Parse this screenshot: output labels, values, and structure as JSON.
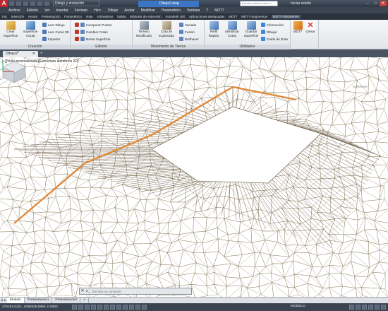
{
  "title_bar": {
    "logo": "A",
    "workspace": "Dibujo y anotación",
    "file_title": "Dibujo2.dwg",
    "search_placeholder": "Escriba palabra clave o frase",
    "login": "Iniciar sesión",
    "window_controls": [
      "–",
      "□",
      "✕"
    ]
  },
  "menu": [
    "Archivo",
    "Edición",
    "Ver",
    "Insertar",
    "Formato",
    "Herr.",
    "Dibujo",
    "Acotar",
    "Modificar",
    "Paramétrico",
    "Ventana",
    "?",
    "MDT7"
  ],
  "ribbon_tabs": [
    "Inic",
    "Inserción",
    "Anotar",
    "Presentación",
    "Paramétrico",
    "Vista",
    "Administrar",
    "Salida",
    "Módulos de extensión",
    "Autodesk 360",
    "Aplicaciones destacadas",
    "MDT7",
    "MDT7-Segmentos",
    "MDT7-Volúmenes"
  ],
  "ribbon": {
    "creation": {
      "title": "Creación",
      "crear_superficie": "Crear Superficie",
      "superficie_actual": "Superficie Actual",
      "leer_dibujo": "Leer Dibujo",
      "leer_caras_3d": "Leer Caras 3D",
      "importar": "Importar"
    },
    "edicion": {
      "title": "Edición",
      "incorporar_puntos": "Incorporar Puntos",
      "cambiar_cotas": "Cambiar Cotas",
      "borrar_superficie": "Borrar Superficie"
    },
    "movimiento": {
      "title": "Movimiento de Tierras",
      "terreno_modificado": "Terreno Modificado",
      "cota_explanada": "Cota de Explanada",
      "vaciado": "Vaciado",
      "fusion": "Fusión",
      "deshacer": "Deshacer"
    },
    "utilidades": {
      "title": "Utilidades",
      "perfil_rapido": "Perfil Rápido",
      "identificar_cotas": "Identificar Cotas",
      "guardar_superficie": "Guardar Superficie",
      "informacion": "Información",
      "dibujar": "Dibujar",
      "caida_gota": "Caída de Gota"
    },
    "mdt7": {
      "label": "MDT7",
      "cerrar": "Cerrar"
    }
  },
  "document": {
    "tab": "Dibujo2*",
    "close": "✕",
    "add": "+"
  },
  "viewport": {
    "label": "[–][Vista personalizada][Estructura alámbrica 2D]",
    "viewcube": "SUPERIOR"
  },
  "command_line": {
    "placeholder": "Escriba un comando",
    "close": "✕",
    "prompt": "▸_"
  },
  "layout_tabs": {
    "nav": [
      "◂",
      "▸"
    ],
    "tabs": [
      "Modelo",
      "Presentación1",
      "Presentación2"
    ],
    "add": "+"
  },
  "status": {
    "coords": "275193.0221, 4096929.5866, 0.0000",
    "mode": "MODELO"
  },
  "colors": {
    "mesh": "#8a7a5a",
    "mesh_dark": "#5a4a35",
    "edge": "#e08a3a"
  }
}
